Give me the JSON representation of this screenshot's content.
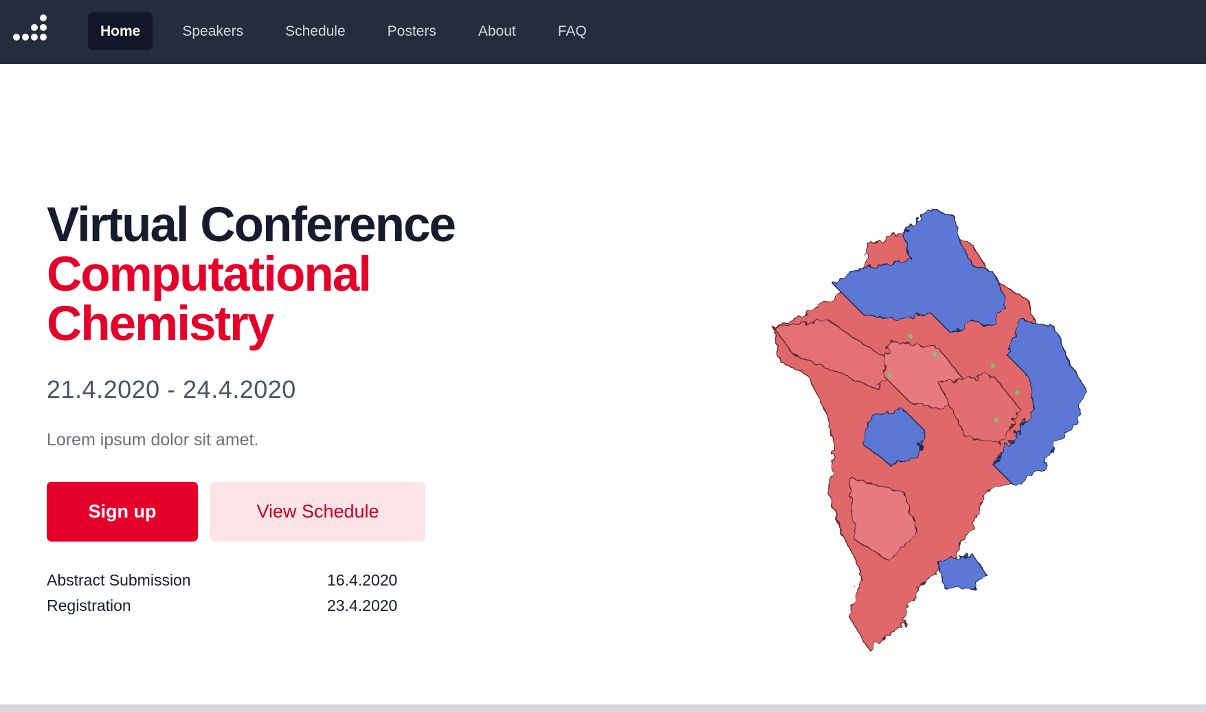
{
  "nav": {
    "items": [
      {
        "label": "Home",
        "active": true
      },
      {
        "label": "Speakers",
        "active": false
      },
      {
        "label": "Schedule",
        "active": false
      },
      {
        "label": "Posters",
        "active": false
      },
      {
        "label": "About",
        "active": false
      },
      {
        "label": "FAQ",
        "active": false
      }
    ]
  },
  "hero": {
    "title": "Virtual Conference",
    "subtitle_line1": "Computational",
    "subtitle_line2": "Chemistry",
    "dates": "21.4.2020 - 24.4.2020",
    "tagline": "Lorem ipsum dolor sit amet.",
    "primary_button": "Sign up",
    "secondary_button": "View Schedule",
    "deadlines": [
      {
        "label": "Abstract Submission",
        "date": "16.4.2020"
      },
      {
        "label": "Registration",
        "date": "23.4.2020"
      }
    ]
  },
  "colors": {
    "nav_bg": "#252c3c",
    "brand_red": "#e5002a",
    "heading_dark": "#161c2d",
    "molecule_red": "#e0676b",
    "molecule_blue": "#5b78d4"
  }
}
